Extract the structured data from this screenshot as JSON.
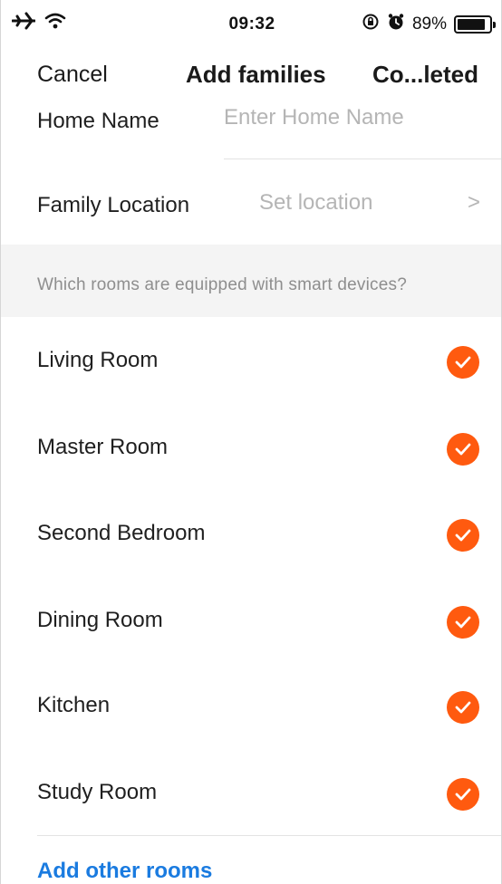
{
  "status_bar": {
    "time": "09:32",
    "battery_percent": "89%",
    "battery_level": 0.89,
    "icons": [
      "airplane-icon",
      "wifi-icon",
      "rotation-lock-icon",
      "alarm-icon",
      "battery-icon"
    ]
  },
  "nav": {
    "cancel_label": "Cancel",
    "title": "Add families",
    "completed_label": "Co...leted"
  },
  "form": {
    "home_name_label": "Home Name",
    "home_name_placeholder": "Enter Home Name",
    "location_label": "Family Location",
    "location_value": "Set location",
    "chevron": ">"
  },
  "rooms_section": {
    "prompt": "Which rooms are equipped with smart devices?",
    "rooms": [
      {
        "label": "Living Room",
        "checked": true
      },
      {
        "label": "Master Room",
        "checked": true
      },
      {
        "label": "Second Bedroom",
        "checked": true
      },
      {
        "label": "Dining Room",
        "checked": true
      },
      {
        "label": "Kitchen",
        "checked": true
      },
      {
        "label": "Study Room",
        "checked": true
      }
    ],
    "add_other_label": "Add other rooms"
  },
  "colors": {
    "accent_check": "#ff5a0f",
    "link_blue": "#1a7be0",
    "section_bg": "#f4f4f4"
  }
}
